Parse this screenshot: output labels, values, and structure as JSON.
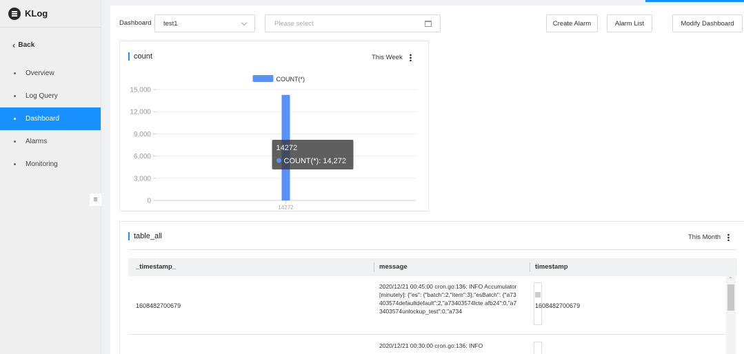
{
  "app": {
    "title": "KLog"
  },
  "sidebar": {
    "back_label": "Back",
    "items": [
      {
        "label": "Overview",
        "active": false
      },
      {
        "label": "Log Query",
        "active": false
      },
      {
        "label": "Dashboard",
        "active": true
      },
      {
        "label": "Alarms",
        "active": false
      },
      {
        "label": "Monitoring",
        "active": false
      }
    ]
  },
  "toolbar": {
    "dashboard_label": "Dashboard",
    "dashboard_value": "test1",
    "date_placeholder": "Please select",
    "create_alarm": "Create Alarm",
    "alarm_list": "Alarm List",
    "modify_dashboard": "Modify Dashboard"
  },
  "count_panel": {
    "title": "count",
    "period": "This Week"
  },
  "chart_data": {
    "type": "bar",
    "categories": [
      "14272"
    ],
    "series": [
      {
        "name": "COUNT(*)",
        "values": [
          14272
        ]
      }
    ],
    "ylim": [
      0,
      15000
    ],
    "yticks": [
      "0",
      "3,000",
      "6,000",
      "9,000",
      "12,000",
      "15,000"
    ],
    "legend": "top-center",
    "grid": true,
    "color": "#5b8ff9",
    "tooltip": {
      "title": "14272",
      "label": "COUNT(*): 14,272"
    }
  },
  "table_panel": {
    "title": "table_all",
    "period": "This Month",
    "columns": [
      "_timestamp_",
      "message",
      "timestamp"
    ],
    "rows": [
      {
        "_timestamp_": "1608482700679",
        "message": "2020/12/21 00:45:00 cron.go:136: INFO Accumulator[minutely]: {\"es\": {\"batch\":2,\"item\":3},\"esBatch\": {\"a73403574defaultdefault\":2,\"a73403574lcte afb24\":0,\"a73403574unlockup_test\":0,\"a734",
        "timestamp": "1608482700679"
      },
      {
        "_timestamp_": "",
        "message": "2020/12/21 00:30:00 cron.go:136: INFO",
        "timestamp": ""
      }
    ]
  }
}
